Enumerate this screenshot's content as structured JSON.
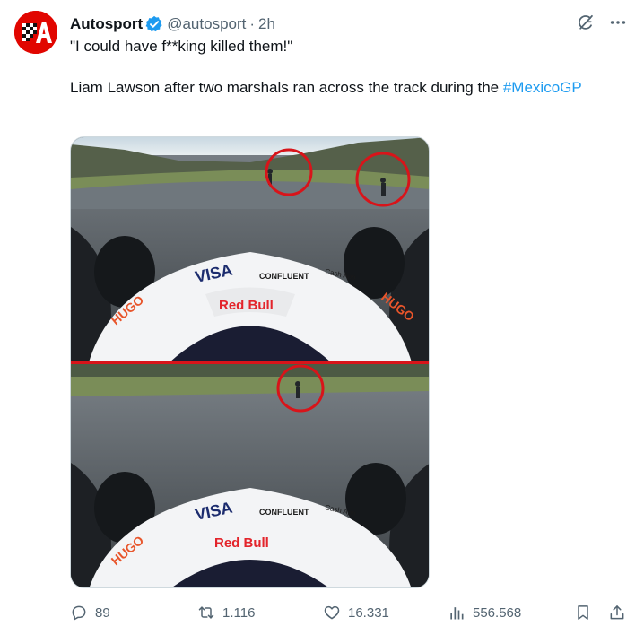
{
  "account": {
    "display_name": "Autosport",
    "handle": "@autosport",
    "separator": "·",
    "time": "2h",
    "avatar_icon": "autosport-logo-icon",
    "verified_icon": "verified-badge-icon",
    "verified_color": "#1d9bf0",
    "brand_color": "#e10600"
  },
  "tweet": {
    "quote": "\"I could have f**king killed them!\"",
    "body_prefix": "Liam Lawson after two marshals ran across the track during the ",
    "hashtag": "#MexicoGP",
    "emoji_icon": "flushed-face-emoji",
    "hashtag_color": "#1d9bf0"
  },
  "media": {
    "type": "two stacked onboard camera frames with red circles marking marshals",
    "circle_color": "#d8141a"
  },
  "actions": {
    "replies": "89",
    "retweets": "1.116",
    "likes": "16.331",
    "views": "556.568",
    "icon_color": "#536471"
  },
  "top_actions": {
    "grok_icon": "grok-icon",
    "more_icon": "more-dots-icon"
  }
}
